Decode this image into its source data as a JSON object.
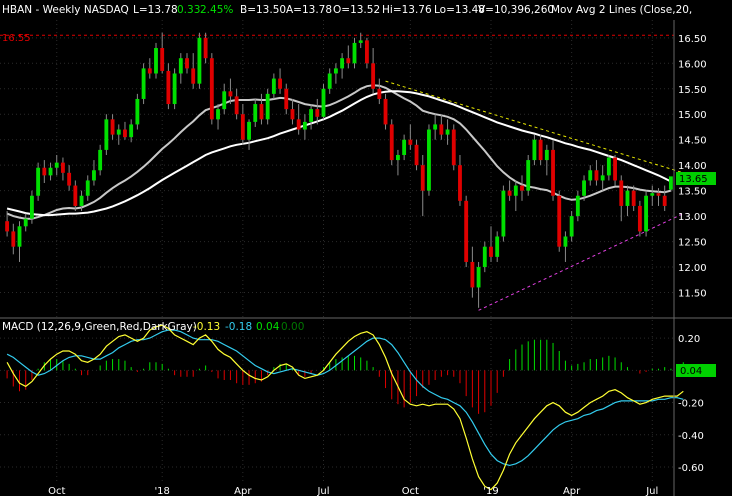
{
  "header": {
    "symbol": "HBAN - Weekly  NASDAQ",
    "low": "L=13.78",
    "change": "0.33",
    "change_pct": "2.45%",
    "bid": "B=13.50",
    "ask": "A=13.78",
    "open": "O=13.52",
    "high": "Hi=13.76",
    "lo": "Lo=13.48",
    "volume": "V=10,396,260",
    "study": "Mov Avg 2 Lines (Close,20,"
  },
  "colors": {
    "up": "#00e000",
    "down": "#e00000",
    "ma_fast": "#c8c8c8",
    "ma_slow": "#ffffff",
    "macd_line": "#ffff33",
    "signal_line": "#33ccee",
    "ref_line": "#e00000",
    "upper_trend": "#e6e600",
    "lower_trend": "#e040e0"
  },
  "ref_line_label": "16.55",
  "last_price_label": "13.65",
  "macd_header": {
    "title": "MACD (12,26,9,Green,Red,DarkGray)",
    "macd": "-0.13",
    "signal": "-0.18",
    "hist": "0.04",
    "extra": "0.00"
  },
  "macd_last_label": "0.04",
  "chart_data": [
    {
      "type": "candlestick",
      "title": "HBAN - Weekly  NASDAQ",
      "x_tick_labels": [
        "Oct",
        "'18",
        "Apr",
        "Jul",
        "Oct",
        "'19",
        "Apr",
        "Jul"
      ],
      "y_tick_labels": [
        "11.50",
        "12.00",
        "12.50",
        "13.00",
        "13.50",
        "14.00",
        "14.50",
        "15.00",
        "15.50",
        "16.00",
        "16.50"
      ],
      "ylim": [
        11.0,
        16.85
      ],
      "reference_line": 16.55,
      "grid": true,
      "ohlc": [
        [
          12.9,
          13.1,
          12.6,
          12.7
        ],
        [
          12.7,
          12.85,
          12.25,
          12.4
        ],
        [
          12.4,
          12.9,
          12.1,
          12.8
        ],
        [
          12.8,
          13.05,
          12.7,
          12.95
        ],
        [
          12.95,
          13.5,
          12.85,
          13.4
        ],
        [
          13.4,
          14.05,
          13.3,
          13.95
        ],
        [
          13.95,
          14.1,
          13.65,
          13.8
        ],
        [
          13.8,
          14.05,
          13.7,
          13.95
        ],
        [
          13.95,
          14.2,
          13.8,
          14.05
        ],
        [
          14.05,
          14.15,
          13.7,
          13.85
        ],
        [
          13.85,
          14.0,
          13.5,
          13.6
        ],
        [
          13.6,
          13.7,
          13.1,
          13.2
        ],
        [
          13.2,
          13.5,
          13.1,
          13.4
        ],
        [
          13.4,
          13.8,
          13.3,
          13.7
        ],
        [
          13.7,
          14.1,
          13.6,
          13.9
        ],
        [
          13.9,
          14.4,
          13.8,
          14.3
        ],
        [
          14.3,
          15.0,
          14.2,
          14.9
        ],
        [
          14.9,
          15.0,
          14.5,
          14.6
        ],
        [
          14.6,
          14.8,
          14.4,
          14.7
        ],
        [
          14.7,
          14.85,
          14.5,
          14.55
        ],
        [
          14.55,
          14.9,
          14.45,
          14.8
        ],
        [
          14.8,
          15.4,
          14.7,
          15.3
        ],
        [
          15.3,
          16.0,
          15.2,
          15.9
        ],
        [
          15.9,
          16.1,
          15.7,
          15.8
        ],
        [
          15.8,
          16.4,
          15.7,
          16.3
        ],
        [
          16.3,
          16.6,
          15.8,
          15.85
        ],
        [
          15.85,
          16.0,
          15.1,
          15.2
        ],
        [
          15.2,
          15.9,
          15.1,
          15.8
        ],
        [
          15.8,
          16.2,
          15.6,
          16.1
        ],
        [
          16.1,
          16.2,
          15.8,
          15.9
        ],
        [
          15.9,
          16.2,
          15.5,
          15.6
        ],
        [
          15.6,
          16.6,
          15.5,
          16.5
        ],
        [
          16.5,
          16.6,
          16.0,
          16.1
        ],
        [
          16.1,
          16.2,
          14.8,
          14.9
        ],
        [
          14.9,
          15.2,
          14.7,
          15.1
        ],
        [
          15.1,
          15.6,
          15.0,
          15.45
        ],
        [
          15.45,
          15.7,
          15.2,
          15.35
        ],
        [
          15.35,
          15.5,
          14.9,
          15.0
        ],
        [
          15.0,
          15.2,
          14.4,
          14.5
        ],
        [
          14.5,
          14.9,
          14.3,
          14.85
        ],
        [
          14.85,
          15.3,
          14.75,
          15.2
        ],
        [
          15.2,
          15.4,
          14.8,
          14.9
        ],
        [
          14.9,
          15.5,
          14.8,
          15.4
        ],
        [
          15.4,
          15.8,
          15.3,
          15.7
        ],
        [
          15.7,
          15.9,
          15.4,
          15.5
        ],
        [
          15.5,
          15.6,
          15.0,
          15.1
        ],
        [
          15.1,
          15.3,
          14.8,
          14.9
        ],
        [
          14.9,
          15.2,
          14.6,
          14.7
        ],
        [
          14.7,
          15.0,
          14.5,
          14.85
        ],
        [
          14.85,
          15.2,
          14.7,
          15.1
        ],
        [
          15.1,
          15.3,
          14.8,
          14.95
        ],
        [
          14.95,
          15.6,
          14.9,
          15.5
        ],
        [
          15.5,
          15.9,
          15.4,
          15.8
        ],
        [
          15.8,
          16.0,
          15.6,
          15.9
        ],
        [
          15.9,
          16.2,
          15.7,
          16.1
        ],
        [
          16.1,
          16.35,
          15.9,
          16.0
        ],
        [
          16.0,
          16.5,
          15.9,
          16.4
        ],
        [
          16.4,
          16.6,
          16.3,
          16.45
        ],
        [
          16.45,
          16.5,
          15.9,
          16.0
        ],
        [
          16.0,
          16.3,
          15.4,
          15.5
        ],
        [
          15.5,
          15.7,
          15.2,
          15.3
        ],
        [
          15.3,
          15.4,
          14.7,
          14.8
        ],
        [
          14.8,
          14.9,
          14.0,
          14.1
        ],
        [
          14.1,
          14.3,
          13.8,
          14.2
        ],
        [
          14.2,
          14.6,
          14.1,
          14.5
        ],
        [
          14.5,
          14.8,
          14.3,
          14.4
        ],
        [
          14.4,
          14.5,
          13.9,
          14.0
        ],
        [
          14.0,
          14.2,
          13.0,
          13.5
        ],
        [
          13.5,
          14.8,
          13.4,
          14.7
        ],
        [
          14.7,
          15.0,
          14.5,
          14.8
        ],
        [
          14.8,
          15.0,
          14.5,
          14.6
        ],
        [
          14.6,
          14.9,
          14.4,
          14.7
        ],
        [
          14.7,
          14.8,
          13.9,
          14.0
        ],
        [
          14.0,
          14.2,
          13.2,
          13.3
        ],
        [
          13.3,
          13.4,
          12.0,
          12.1
        ],
        [
          12.1,
          12.4,
          11.4,
          11.6
        ],
        [
          11.6,
          12.1,
          11.2,
          12.0
        ],
        [
          12.0,
          12.5,
          11.9,
          12.4
        ],
        [
          12.4,
          12.8,
          12.1,
          12.2
        ],
        [
          12.2,
          12.7,
          12.1,
          12.6
        ],
        [
          12.6,
          13.6,
          12.5,
          13.5
        ],
        [
          13.5,
          13.7,
          13.3,
          13.4
        ],
        [
          13.4,
          13.7,
          13.1,
          13.6
        ],
        [
          13.6,
          13.8,
          13.3,
          13.5
        ],
        [
          13.5,
          14.2,
          13.4,
          14.1
        ],
        [
          14.1,
          14.6,
          14.0,
          14.5
        ],
        [
          14.5,
          14.6,
          14.0,
          14.1
        ],
        [
          14.1,
          14.4,
          13.8,
          14.3
        ],
        [
          14.3,
          14.5,
          13.3,
          13.4
        ],
        [
          13.4,
          13.5,
          12.3,
          12.4
        ],
        [
          12.4,
          12.7,
          12.1,
          12.6
        ],
        [
          12.6,
          13.1,
          12.5,
          13.0
        ],
        [
          13.0,
          13.5,
          12.9,
          13.4
        ],
        [
          13.4,
          13.8,
          13.3,
          13.7
        ],
        [
          13.7,
          14.0,
          13.6,
          13.9
        ],
        [
          13.9,
          14.1,
          13.6,
          13.7
        ],
        [
          13.7,
          14.0,
          13.5,
          13.8
        ],
        [
          13.8,
          14.2,
          13.7,
          14.15
        ],
        [
          14.15,
          14.2,
          13.6,
          13.7
        ],
        [
          13.7,
          13.8,
          12.9,
          13.2
        ],
        [
          13.2,
          13.6,
          13.0,
          13.5
        ],
        [
          13.5,
          13.6,
          13.1,
          13.2
        ],
        [
          13.2,
          13.3,
          12.6,
          12.7
        ],
        [
          12.7,
          13.5,
          12.6,
          13.4
        ],
        [
          13.4,
          13.6,
          13.2,
          13.45
        ],
        [
          13.45,
          13.55,
          13.2,
          13.4
        ],
        [
          13.4,
          13.6,
          13.1,
          13.2
        ],
        [
          13.52,
          13.76,
          13.48,
          13.78
        ]
      ],
      "series": [
        {
          "name": "",
          "values": [
            13.05,
            13.0,
            12.97,
            12.95,
            12.95,
            12.98,
            13.02,
            13.07,
            13.12,
            13.15,
            13.16,
            13.15,
            13.17,
            13.22,
            13.28,
            13.36,
            13.46,
            13.55,
            13.63,
            13.7,
            13.78,
            13.87,
            13.97,
            14.08,
            14.2,
            14.32,
            14.42,
            14.53,
            14.65,
            14.76,
            14.86,
            14.98,
            15.08,
            15.12,
            15.16,
            15.21,
            15.26,
            15.28,
            15.28,
            15.28,
            15.29,
            15.28,
            15.28,
            15.3,
            15.32,
            15.31,
            15.28,
            15.24,
            15.2,
            15.18,
            15.16,
            15.15,
            15.18,
            15.23,
            15.29,
            15.35,
            15.42,
            15.5,
            15.55,
            15.57,
            15.56,
            15.52,
            15.45,
            15.38,
            15.31,
            15.25,
            15.17,
            15.07,
            15.03,
            15.0,
            14.98,
            14.95,
            14.9,
            14.82,
            14.7,
            14.56,
            14.42,
            14.28,
            14.13,
            13.98,
            13.86,
            13.76,
            13.68,
            13.62,
            13.58,
            13.56,
            13.53,
            13.51,
            13.46,
            13.4,
            13.35,
            13.32,
            13.33,
            13.36,
            13.4,
            13.45,
            13.5,
            13.55,
            13.58,
            13.58,
            13.57,
            13.55,
            13.52,
            13.5,
            13.49,
            13.48,
            13.47,
            13.5
          ]
        },
        {
          "name": "",
          "values": [
            13.15,
            13.12,
            13.09,
            13.06,
            13.04,
            13.03,
            13.02,
            13.02,
            13.03,
            13.04,
            13.05,
            13.05,
            13.06,
            13.07,
            13.09,
            13.12,
            13.15,
            13.19,
            13.24,
            13.29,
            13.35,
            13.41,
            13.48,
            13.55,
            13.63,
            13.71,
            13.78,
            13.85,
            13.92,
            13.99,
            14.06,
            14.13,
            14.2,
            14.25,
            14.29,
            14.33,
            14.37,
            14.4,
            14.42,
            14.44,
            14.47,
            14.5,
            14.53,
            14.57,
            14.62,
            14.66,
            14.7,
            14.74,
            14.78,
            14.82,
            14.86,
            14.9,
            14.95,
            15.01,
            15.07,
            15.14,
            15.21,
            15.28,
            15.34,
            15.39,
            15.42,
            15.44,
            15.45,
            15.45,
            15.44,
            15.43,
            15.41,
            15.38,
            15.35,
            15.31,
            15.27,
            15.23,
            15.19,
            15.14,
            15.09,
            15.04,
            14.99,
            14.94,
            14.89,
            14.84,
            14.8,
            14.76,
            14.72,
            14.68,
            14.65,
            14.62,
            14.58,
            14.55,
            14.51,
            14.47,
            14.43,
            14.4,
            14.36,
            14.33,
            14.3,
            14.26,
            14.22,
            14.18,
            14.14,
            14.1,
            14.05,
            14.0,
            13.95,
            13.9,
            13.85,
            13.8,
            13.74,
            13.68
          ]
        }
      ],
      "trendlines": [
        {
          "name": "",
          "from": [
            61,
            15.65
          ],
          "to": [
            109,
            13.85
          ]
        },
        {
          "name": "",
          "from": [
            76,
            11.15
          ],
          "to": [
            109,
            13.05
          ]
        }
      ]
    },
    {
      "type": "line",
      "title": "MACD (12,26,9,Green,Red,DarkGray)",
      "y_tick_labels": [
        "0.20",
        "0.00",
        "-0.20",
        "-0.40",
        "-0.60"
      ],
      "ylim": [
        -0.78,
        0.3
      ],
      "grid": true,
      "series": [
        {
          "name": "",
          "values": [
            0.05,
            -0.02,
            -0.08,
            -0.1,
            -0.07,
            -0.02,
            0.03,
            0.07,
            0.1,
            0.12,
            0.12,
            0.1,
            0.06,
            0.05,
            0.07,
            0.1,
            0.15,
            0.18,
            0.21,
            0.22,
            0.2,
            0.18,
            0.2,
            0.25,
            0.27,
            0.28,
            0.26,
            0.22,
            0.2,
            0.18,
            0.16,
            0.2,
            0.22,
            0.18,
            0.13,
            0.1,
            0.08,
            0.04,
            0.0,
            -0.03,
            -0.05,
            -0.06,
            -0.04,
            0.0,
            0.03,
            0.04,
            0.02,
            -0.03,
            -0.05,
            -0.04,
            -0.03,
            0.0,
            0.05,
            0.1,
            0.14,
            0.18,
            0.21,
            0.23,
            0.24,
            0.22,
            0.16,
            0.08,
            -0.02,
            -0.1,
            -0.18,
            -0.21,
            -0.22,
            -0.21,
            -0.22,
            -0.21,
            -0.21,
            -0.21,
            -0.24,
            -0.3,
            -0.42,
            -0.55,
            -0.66,
            -0.72,
            -0.74,
            -0.7,
            -0.62,
            -0.52,
            -0.45,
            -0.4,
            -0.35,
            -0.3,
            -0.26,
            -0.22,
            -0.2,
            -0.22,
            -0.26,
            -0.28,
            -0.26,
            -0.23,
            -0.2,
            -0.18,
            -0.16,
            -0.13,
            -0.12,
            -0.14,
            -0.17,
            -0.19,
            -0.21,
            -0.2,
            -0.18,
            -0.17,
            -0.16,
            -0.16,
            -0.16,
            -0.13
          ]
        },
        {
          "name": "",
          "values": [
            0.1,
            0.08,
            0.05,
            0.02,
            -0.01,
            -0.03,
            -0.02,
            0.0,
            0.03,
            0.06,
            0.08,
            0.09,
            0.09,
            0.08,
            0.07,
            0.07,
            0.09,
            0.11,
            0.14,
            0.16,
            0.18,
            0.19,
            0.19,
            0.2,
            0.22,
            0.24,
            0.25,
            0.25,
            0.24,
            0.22,
            0.2,
            0.19,
            0.19,
            0.19,
            0.18,
            0.16,
            0.14,
            0.12,
            0.09,
            0.06,
            0.03,
            0.01,
            -0.01,
            -0.02,
            -0.01,
            0.0,
            0.01,
            0.0,
            -0.01,
            -0.02,
            -0.03,
            -0.02,
            0.0,
            0.03,
            0.06,
            0.09,
            0.12,
            0.15,
            0.18,
            0.2,
            0.2,
            0.19,
            0.16,
            0.11,
            0.05,
            -0.01,
            -0.06,
            -0.1,
            -0.13,
            -0.15,
            -0.17,
            -0.18,
            -0.2,
            -0.22,
            -0.26,
            -0.32,
            -0.39,
            -0.46,
            -0.52,
            -0.56,
            -0.58,
            -0.59,
            -0.58,
            -0.56,
            -0.53,
            -0.49,
            -0.45,
            -0.41,
            -0.37,
            -0.34,
            -0.32,
            -0.31,
            -0.3,
            -0.28,
            -0.27,
            -0.25,
            -0.24,
            -0.22,
            -0.2,
            -0.19,
            -0.19,
            -0.19,
            -0.19,
            -0.19,
            -0.19,
            -0.18,
            -0.18,
            -0.17,
            -0.17,
            -0.18
          ]
        }
      ]
    }
  ]
}
